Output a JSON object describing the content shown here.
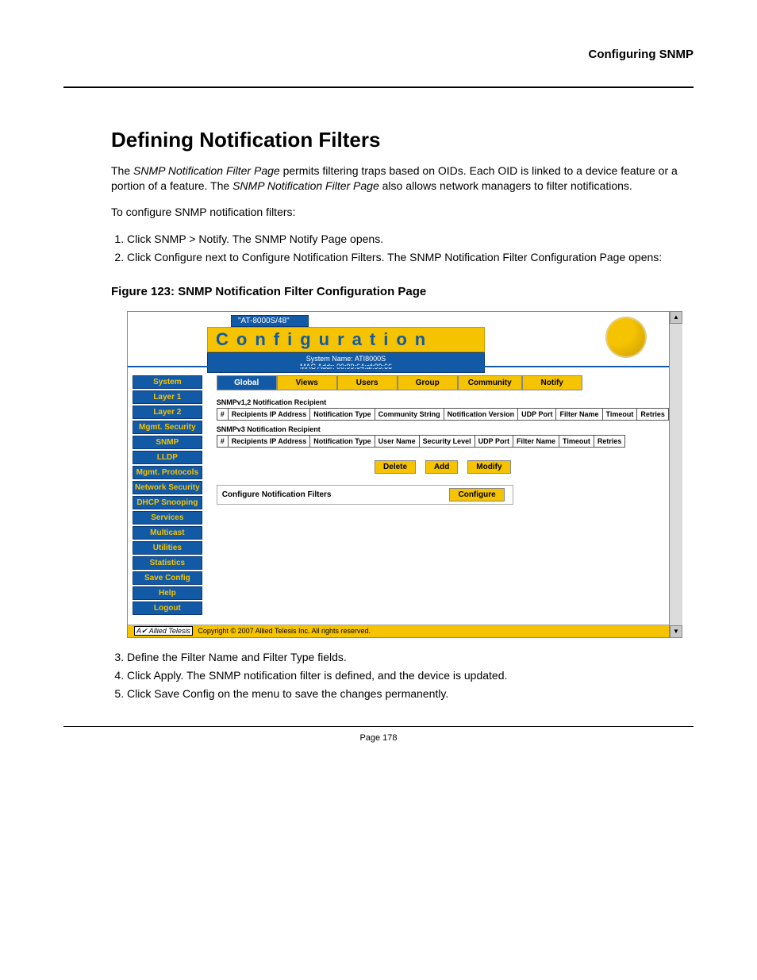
{
  "header": {
    "chapter": "Configuring SNMP"
  },
  "section": {
    "title": "Defining Notification Filters"
  },
  "intro": {
    "p1_a": "The ",
    "p1_i1": "SNMP Notification Filter Page",
    "p1_b": " permits filtering traps based on OIDs. Each OID is linked to a device feature or a portion of a feature. The ",
    "p1_i2": "SNMP Notification Filter Page",
    "p1_c": " also allows network managers to filter notifications.",
    "p2": "To configure SNMP notification filters:"
  },
  "steps_top": {
    "s1_a": "Click ",
    "s1_b": "SNMP > Notify",
    "s1_c": ". The ",
    "s1_i": "SNMP Notify Page",
    "s1_d": " opens.",
    "s2_a": "Click ",
    "s2_b": "Configure",
    "s2_c": " next to ",
    "s2_i1": "Configure Notification Filters",
    "s2_d": ". The ",
    "s2_i2": "SNMP Notification Filter Configuration Page",
    "s2_e": " opens:"
  },
  "figure": {
    "caption": "Figure 123: SNMP Notification Filter Configuration Page"
  },
  "app": {
    "device_tab": "\"AT-8000S/48\"",
    "title": "Configuration",
    "sys_line1": "System Name: ATI8000S",
    "sys_line2": "MAC Addr:  00:99:64:af:99:66",
    "sidebar": [
      "System",
      "Layer 1",
      "Layer 2",
      "Mgmt. Security",
      "SNMP",
      "LLDP",
      "Mgmt. Protocols",
      "Network Security",
      "DHCP Snooping",
      "Services",
      "Multicast",
      "Utilities",
      "Statistics",
      "Save Config",
      "Help",
      "Logout"
    ],
    "tabs": [
      "Global",
      "Views",
      "Users",
      "Group",
      "Community",
      "Notify"
    ],
    "active_tab_index": 5,
    "sec1_label": "SNMPv1,2 Notification Recipient",
    "sec1_cols": [
      "#",
      "Recipients IP Address",
      "Notification Type",
      "Community String",
      "Notification Version",
      "UDP Port",
      "Filter Name",
      "Timeout",
      "Retries"
    ],
    "sec2_label": "SNMPv3 Notification Recipient",
    "sec2_cols": [
      "#",
      "Recipients IP Address",
      "Notification Type",
      "User Name",
      "Security Level",
      "UDP Port",
      "Filter Name",
      "Timeout",
      "Retries"
    ],
    "buttons": {
      "delete": "Delete",
      "add": "Add",
      "modify": "Modify",
      "configure": "Configure"
    },
    "config_filters_label": "Configure Notification Filters",
    "footer_logo": "A✔ Allied Telesis",
    "footer_text": "Copyright © 2007 Allied Telesis Inc. All rights reserved."
  },
  "steps_bottom": {
    "s3_a": "Define the ",
    "s3_i1": "Filter Name",
    "s3_b": " and ",
    "s3_i2": "Filter Type",
    "s3_c": " fields.",
    "s4_a": "Click ",
    "s4_b": "Apply",
    "s4_c": ". The SNMP notification filter is defined, and the device is updated.",
    "s5_a": "Click ",
    "s5_b": "Save Config",
    "s5_c": " on the menu to save the changes permanently."
  },
  "page_num": "Page 178"
}
